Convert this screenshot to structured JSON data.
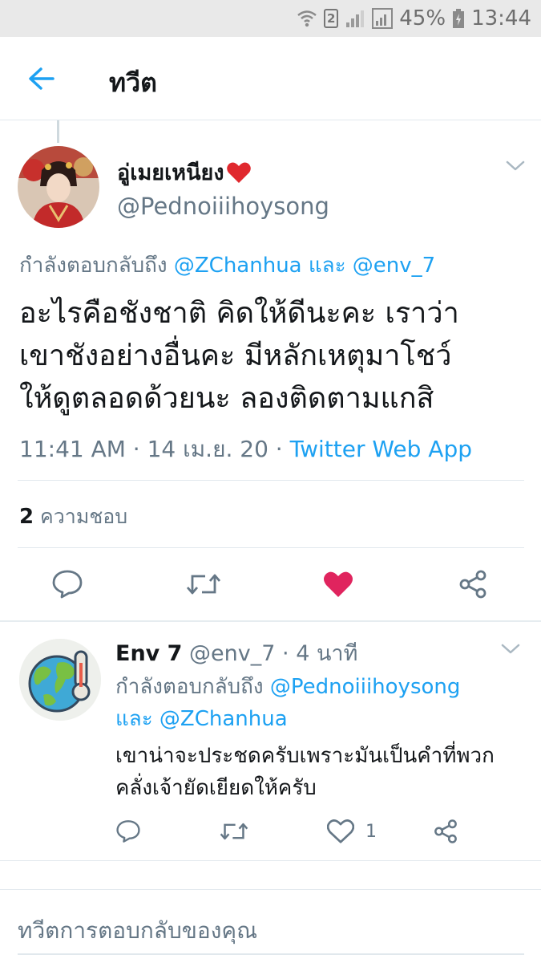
{
  "status_bar": {
    "sim_number": "2",
    "battery": "45%",
    "time": "13:44"
  },
  "app_bar": {
    "title": "ทวีต",
    "back_icon": "arrow-left-icon"
  },
  "main_tweet": {
    "display_name": "อู่เมยเหนียง",
    "handle": "@Pednoiiihoysong",
    "replying_prefix": "กำลังตอบกลับถึง",
    "replying_user1": "@ZChanhua",
    "replying_and": "และ",
    "replying_user2": "@env_7",
    "text_line1": "อะไรคือชังชาติ คิดให้ดีนะคะ เราว่า",
    "text_line2": "เขาชังอย่างอื่นคะ มีหลักเหตุมาโชว์",
    "text_line3": "ให้ดูตลอดด้วยนะ ลองติดตามแกสิ",
    "timestamp": "11:41 AM · 14 เม.ย. 20 · ",
    "source": "Twitter Web App",
    "likes_count": "2",
    "likes_label": "ความชอบ",
    "liked": true,
    "accent_color": "#1da1f2",
    "like_color": "#e0245e"
  },
  "reply_tweet": {
    "display_name": "Env 7",
    "handle": "@env_7",
    "time_ago": "· 4 นาที",
    "replying_prefix": "กำลังตอบกลับถึง",
    "replying_user1": "@Pednoiiihoysong",
    "replying_and": "และ",
    "replying_user2": "@ZChanhua",
    "text_line1": "เขาน่าจะประชดครับเพราะมันเป็นคำที่พวก",
    "text_line2": "คลั่งเจ้ายัดเยียดให้ครับ",
    "like_count": "1"
  },
  "compose": {
    "placeholder": "ทวีตการตอบกลับของคุณ"
  }
}
